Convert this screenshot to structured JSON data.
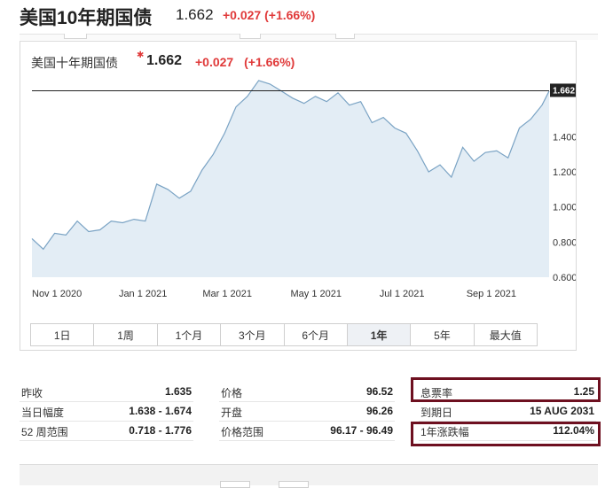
{
  "header": {
    "title": "美国10年期国债",
    "price": "1.662",
    "change": "+0.027 (+1.66%)"
  },
  "chart_panel": {
    "title": "美国十年期国债",
    "price": "1.662",
    "change": "+0.027",
    "change_pct": "(+1.66%)",
    "last_value_label": "1.662",
    "range_buttons": [
      {
        "label": "1日"
      },
      {
        "label": "1周"
      },
      {
        "label": "1个月"
      },
      {
        "label": "3个月"
      },
      {
        "label": "6个月"
      },
      {
        "label": "1年",
        "active": true
      },
      {
        "label": "5年"
      },
      {
        "label": "最大值"
      }
    ]
  },
  "chart_data": {
    "type": "area",
    "title": "美国十年期国债",
    "xlabel": "",
    "ylabel": "",
    "x_tick_labels": [
      "Nov 1 2020",
      "Jan 1 2021",
      "Mar 1 2021",
      "May 1 2021",
      "Jul 1 2021",
      "Sep 1 2021"
    ],
    "y_tick_labels": [
      "0.600",
      "0.800",
      "1.000",
      "1.200",
      "1.400"
    ],
    "y_ticks": [
      0.6,
      0.8,
      1.0,
      1.2,
      1.4
    ],
    "ylim": [
      0.6,
      1.75
    ],
    "x_range": [
      "2020-10-12",
      "2021-10-12"
    ],
    "reference_line": 1.662,
    "grid": false,
    "series": [
      {
        "x": [
          "2020-10-12",
          "2020-10-20",
          "2020-10-28",
          "2020-11-05",
          "2020-11-13",
          "2020-11-21",
          "2020-11-29",
          "2020-12-07",
          "2020-12-15",
          "2020-12-23",
          "2020-12-31",
          "2021-01-08",
          "2021-01-16",
          "2021-01-24",
          "2021-02-01",
          "2021-02-09",
          "2021-02-17",
          "2021-02-25",
          "2021-03-05",
          "2021-03-13",
          "2021-03-21",
          "2021-03-29",
          "2021-04-06",
          "2021-04-14",
          "2021-04-22",
          "2021-04-30",
          "2021-05-08",
          "2021-05-16",
          "2021-05-24",
          "2021-06-01",
          "2021-06-09",
          "2021-06-17",
          "2021-06-25",
          "2021-07-03",
          "2021-07-11",
          "2021-07-19",
          "2021-07-27",
          "2021-08-04",
          "2021-08-12",
          "2021-08-20",
          "2021-08-28",
          "2021-09-05",
          "2021-09-13",
          "2021-09-21",
          "2021-09-29",
          "2021-10-07",
          "2021-10-12"
        ],
        "values": [
          0.82,
          0.76,
          0.85,
          0.84,
          0.92,
          0.86,
          0.87,
          0.92,
          0.91,
          0.93,
          0.92,
          1.13,
          1.1,
          1.05,
          1.09,
          1.21,
          1.3,
          1.42,
          1.57,
          1.63,
          1.72,
          1.7,
          1.66,
          1.62,
          1.59,
          1.63,
          1.6,
          1.65,
          1.58,
          1.6,
          1.48,
          1.51,
          1.45,
          1.42,
          1.32,
          1.2,
          1.24,
          1.17,
          1.34,
          1.26,
          1.31,
          1.32,
          1.28,
          1.45,
          1.5,
          1.58,
          1.66
        ]
      }
    ]
  },
  "stats": {
    "col1": [
      {
        "label": "昨收",
        "value": "1.635"
      },
      {
        "label": "当日幅度",
        "value": "1.638 - 1.674"
      },
      {
        "label": "52 周范围",
        "value": "0.718 - 1.776"
      }
    ],
    "col2": [
      {
        "label": "价格",
        "value": "96.52"
      },
      {
        "label": "开盘",
        "value": "96.26"
      },
      {
        "label": "价格范围",
        "value": "96.17 - 96.49"
      }
    ],
    "col3": [
      {
        "label": "息票率",
        "value": "1.25"
      },
      {
        "label": "到期日",
        "value": "15 AUG 2031"
      },
      {
        "label": "1年涨跌幅",
        "value": "112.04%"
      }
    ]
  }
}
